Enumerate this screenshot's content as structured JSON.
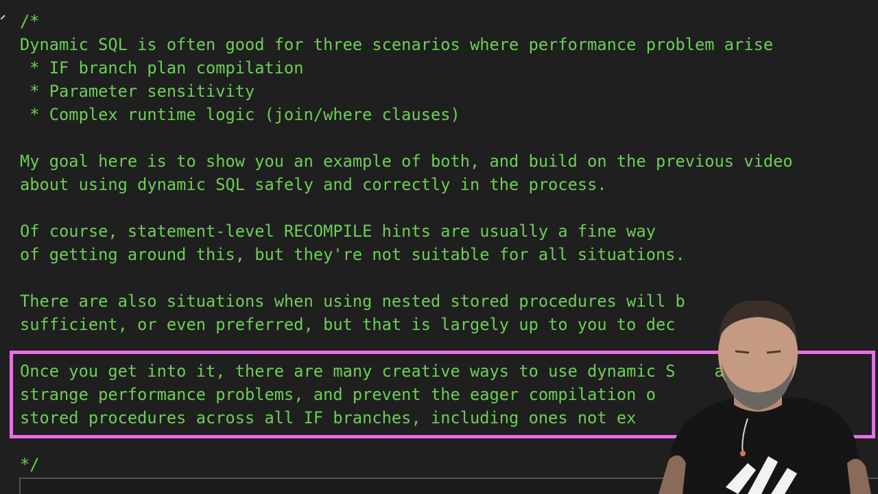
{
  "editor": {
    "lines": [
      "/*",
      "Dynamic SQL is often good for three scenarios where performance problem arise",
      " * IF branch plan compilation",
      " * Parameter sensitivity",
      " * Complex runtime logic (join/where clauses)",
      "",
      "My goal here is to show you an example of both, and build on the previous video",
      "about using dynamic SQL safely and correctly in the process.",
      "",
      "Of course, statement-level RECOMPILE hints are usually a fine way",
      "of getting around this, but they're not suitable for all situations.",
      "",
      "There are also situations when using nested stored procedures will b",
      "sufficient, or even preferred, but that is largely up to you to dec",
      "",
      "Once you get into it, there are many creative ways to use dynamic S    avoid",
      "strange performance problems, and prevent the eager compilation o        n",
      "stored procedures across all IF branches, including ones not ex              e.",
      "",
      "*/"
    ]
  },
  "colors": {
    "background": "#1f1f1f",
    "comment_text": "#6ccf55",
    "highlight_border": "#e86ee8"
  },
  "webcam": {
    "description_icon": "presenter-webcam"
  }
}
